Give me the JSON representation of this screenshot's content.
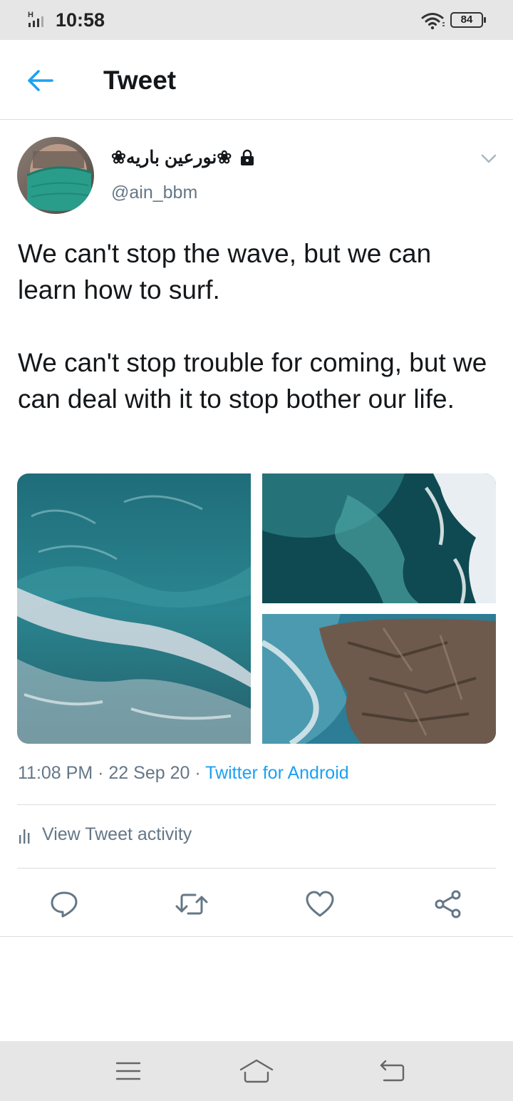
{
  "status_bar": {
    "time": "10:58",
    "network": "H",
    "battery": "84"
  },
  "header": {
    "title": "Tweet"
  },
  "tweet": {
    "author_name": "❀نورعين باريه❀",
    "author_handle": "@ain_bbm",
    "paragraphs": [
      "We can't stop the wave, but we can learn how to surf.",
      "We can't stop trouble for coming, but we can deal with it to stop bother our life."
    ],
    "time": "11:08 PM",
    "separator": "·",
    "date": "22 Sep 20",
    "source": "Twitter for Android",
    "activity_label": "View Tweet activity"
  },
  "actions": {
    "icons": [
      "reply-icon",
      "retweet-icon",
      "like-icon",
      "share-icon"
    ]
  },
  "nav_bar": {
    "icons": [
      "menu-icon",
      "home-icon",
      "back-icon"
    ]
  },
  "colors": {
    "accent": "#1da1f2",
    "secondary_text": "#657786",
    "primary_text": "#14171a",
    "divider": "#d9dee2",
    "system_bar": "#e6e6e6"
  }
}
